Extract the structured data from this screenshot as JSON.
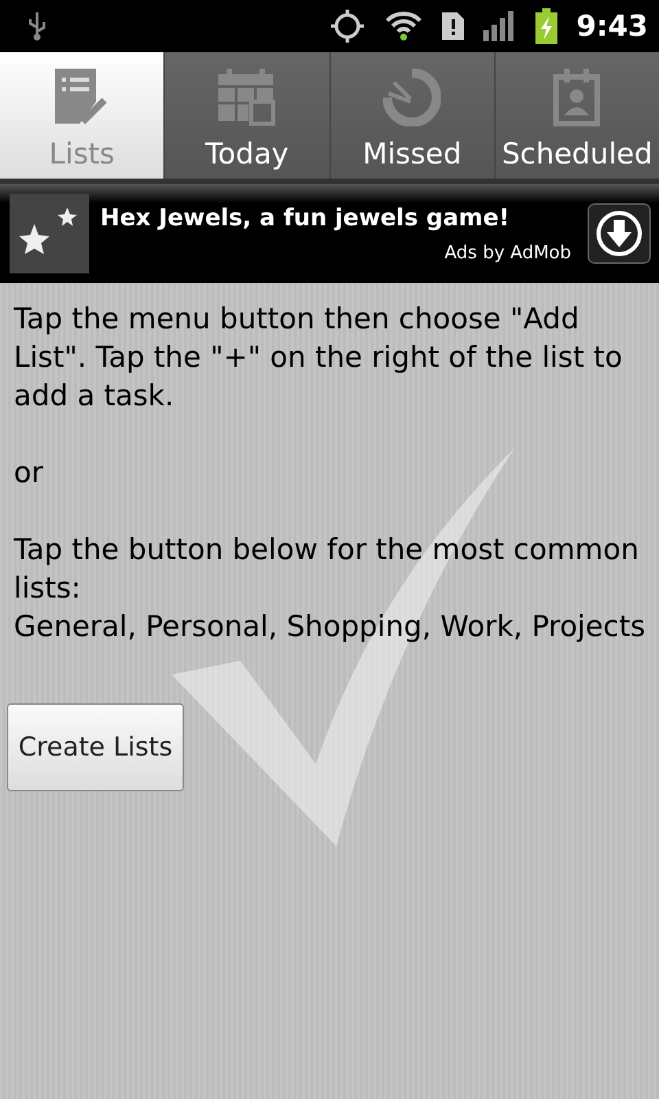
{
  "status_bar": {
    "time": "9:43"
  },
  "tabs": [
    {
      "label": "Lists",
      "selected": true,
      "kind": "lists"
    },
    {
      "label": "Today",
      "selected": false,
      "kind": "today"
    },
    {
      "label": "Missed",
      "selected": false,
      "kind": "missed"
    },
    {
      "label": "Scheduled",
      "selected": false,
      "kind": "scheduled"
    }
  ],
  "ad": {
    "title": "Hex Jewels, a fun jewels game!",
    "source": "Ads by AdMob"
  },
  "instructions": [
    "Tap the menu button then choose \"Add List\". Tap the \"+\" on the right of the list to add a task.",
    "or",
    "Tap the button below for the most common lists:",
    "General, Personal, Shopping, Work, Projects"
  ],
  "button": "Create Lists"
}
